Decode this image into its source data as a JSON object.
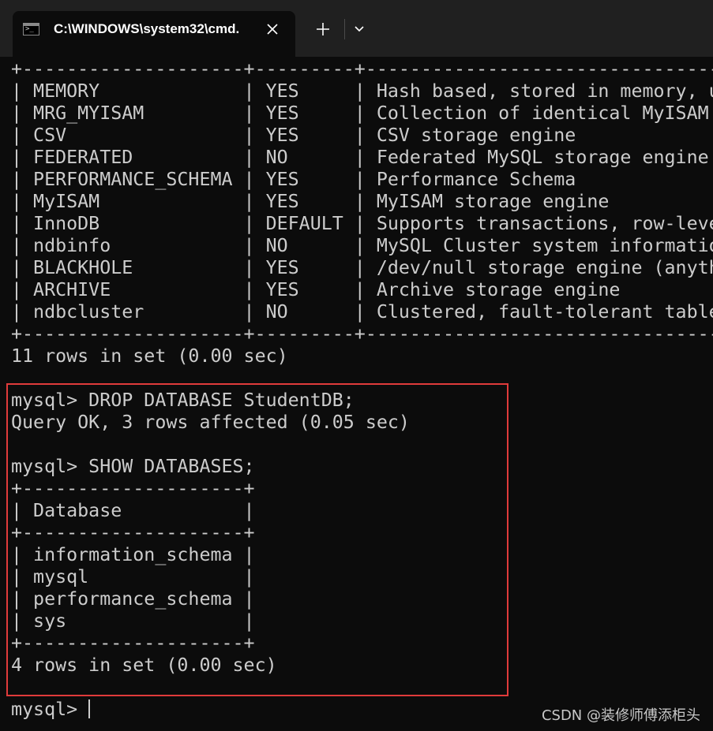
{
  "window": {
    "tab_title": "C:\\WINDOWS\\system32\\cmd.",
    "tab_icon": "cmd-icon",
    "icons": {
      "close": "close-icon",
      "new_tab": "plus-icon",
      "dropdown": "chevron-down-icon"
    }
  },
  "terminal": {
    "lines": [
      "+--------------------+---------+------------------------------------------------------",
      "| MEMORY             | YES     | Hash based, stored in memory, u",
      "| MRG_MYISAM         | YES     | Collection of identical MyISAM",
      "| CSV                | YES     | CSV storage engine",
      "| FEDERATED          | NO      | Federated MySQL storage engine",
      "| PERFORMANCE_SCHEMA | YES     | Performance Schema",
      "| MyISAM             | YES     | MyISAM storage engine",
      "| InnoDB             | DEFAULT | Supports transactions, row-leve",
      "| ndbinfo            | NO      | MySQL Cluster system informatio",
      "| BLACKHOLE          | YES     | /dev/null storage engine (anyth",
      "| ARCHIVE            | YES     | Archive storage engine",
      "| ndbcluster         | NO      | Clustered, fault-tolerant table",
      "+--------------------+---------+------------------------------------------------------",
      "11 rows in set (0.00 sec)",
      "",
      "mysql> DROP DATABASE StudentDB;",
      "Query OK, 3 rows affected (0.05 sec)",
      "",
      "mysql> SHOW DATABASES;",
      "+--------------------+",
      "| Database           |",
      "+--------------------+",
      "| information_schema |",
      "| mysql              |",
      "| performance_schema |",
      "| sys                |",
      "+--------------------+",
      "4 rows in set (0.00 sec)",
      "",
      "mysql> "
    ]
  },
  "highlight_color": "#e03b3b",
  "watermark": "CSDN @装修师傅添柜头"
}
